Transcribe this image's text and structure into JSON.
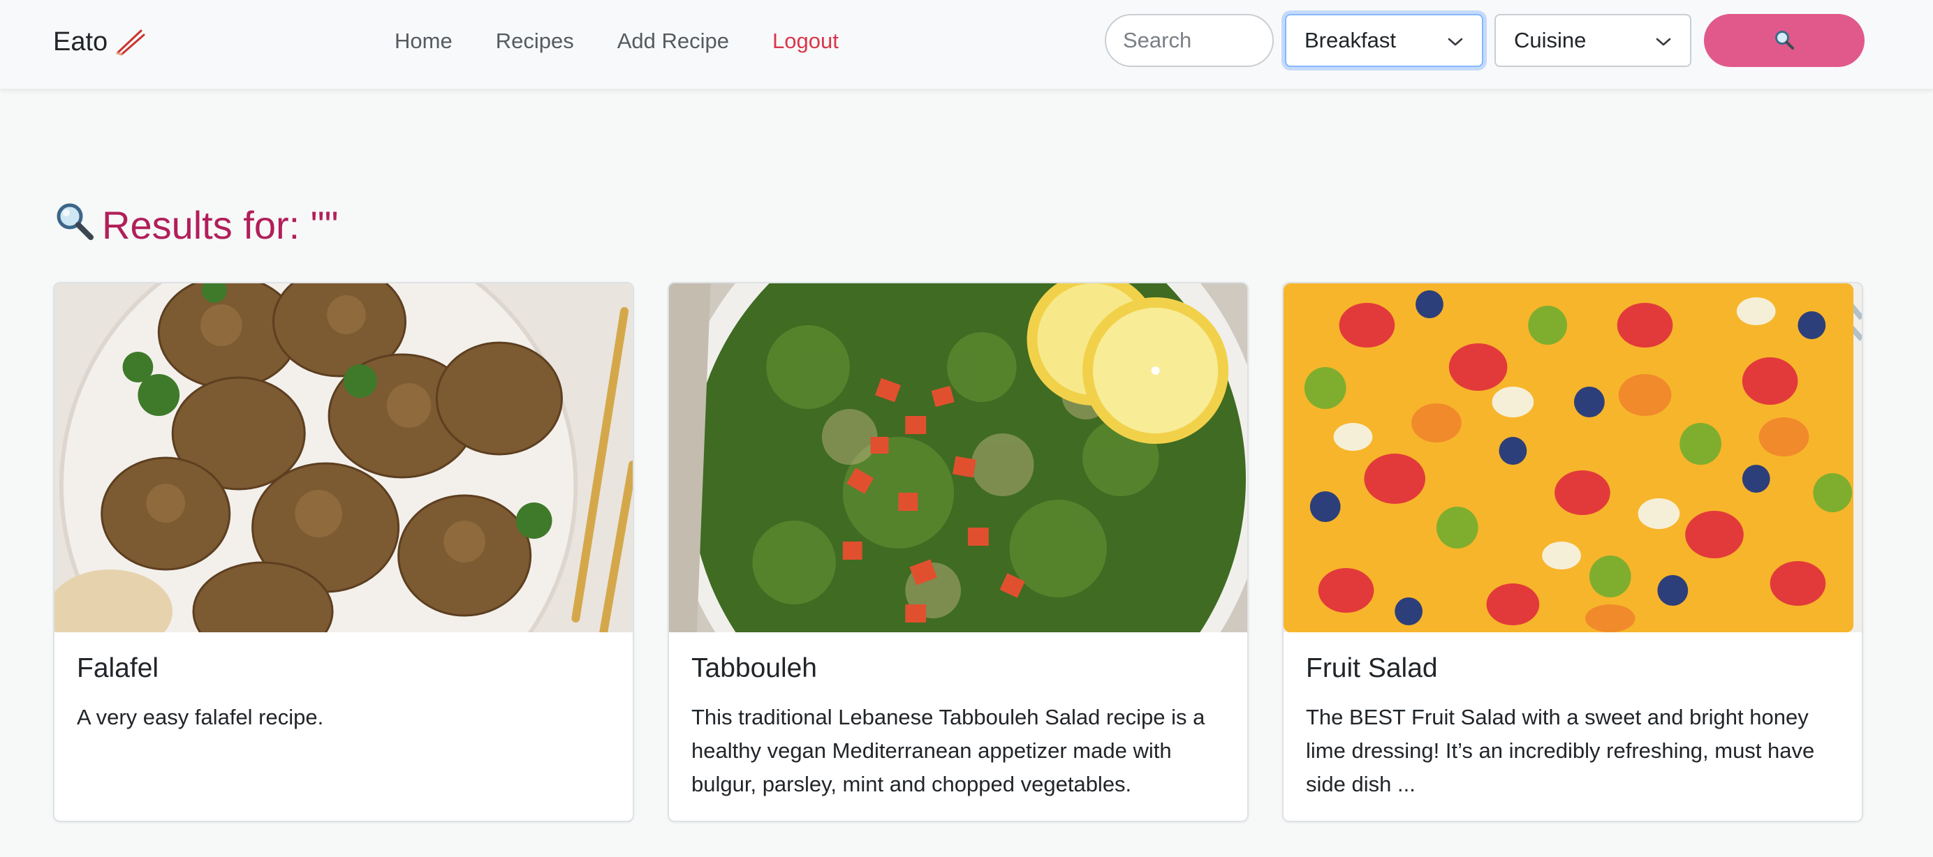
{
  "navbar": {
    "brand": "Eato",
    "brand_icon": "chopsticks-icon",
    "links": [
      "Home",
      "Recipes",
      "Add Recipe",
      "Logout"
    ],
    "search_placeholder": "Search",
    "category_select": "Breakfast",
    "cuisine_select": "Cuisine",
    "search_button_icon": "magnifier-icon",
    "colors": {
      "logout": "#d9364a",
      "search_button": "#e0598a"
    }
  },
  "results": {
    "heading": "Results for: \"\"",
    "heading_icon": "magnifier-icon",
    "heading_color": "#b11f5a"
  },
  "cards": [
    {
      "title": "Falafel",
      "text": "A very easy falafel recipe.",
      "image": "falafel-photo"
    },
    {
      "title": "Tabbouleh",
      "text": "This traditional Lebanese Tabbouleh Salad recipe is a healthy vegan Mediterranean appetizer made with bulgur, parsley, mint and chopped vegetables.",
      "image": "tabbouleh-photo"
    },
    {
      "title": "Fruit Salad",
      "text": "The BEST Fruit Salad with a sweet and bright honey lime dressing! It’s an incredibly refreshing, must have side dish ...",
      "image": "fruit-salad-photo"
    }
  ]
}
